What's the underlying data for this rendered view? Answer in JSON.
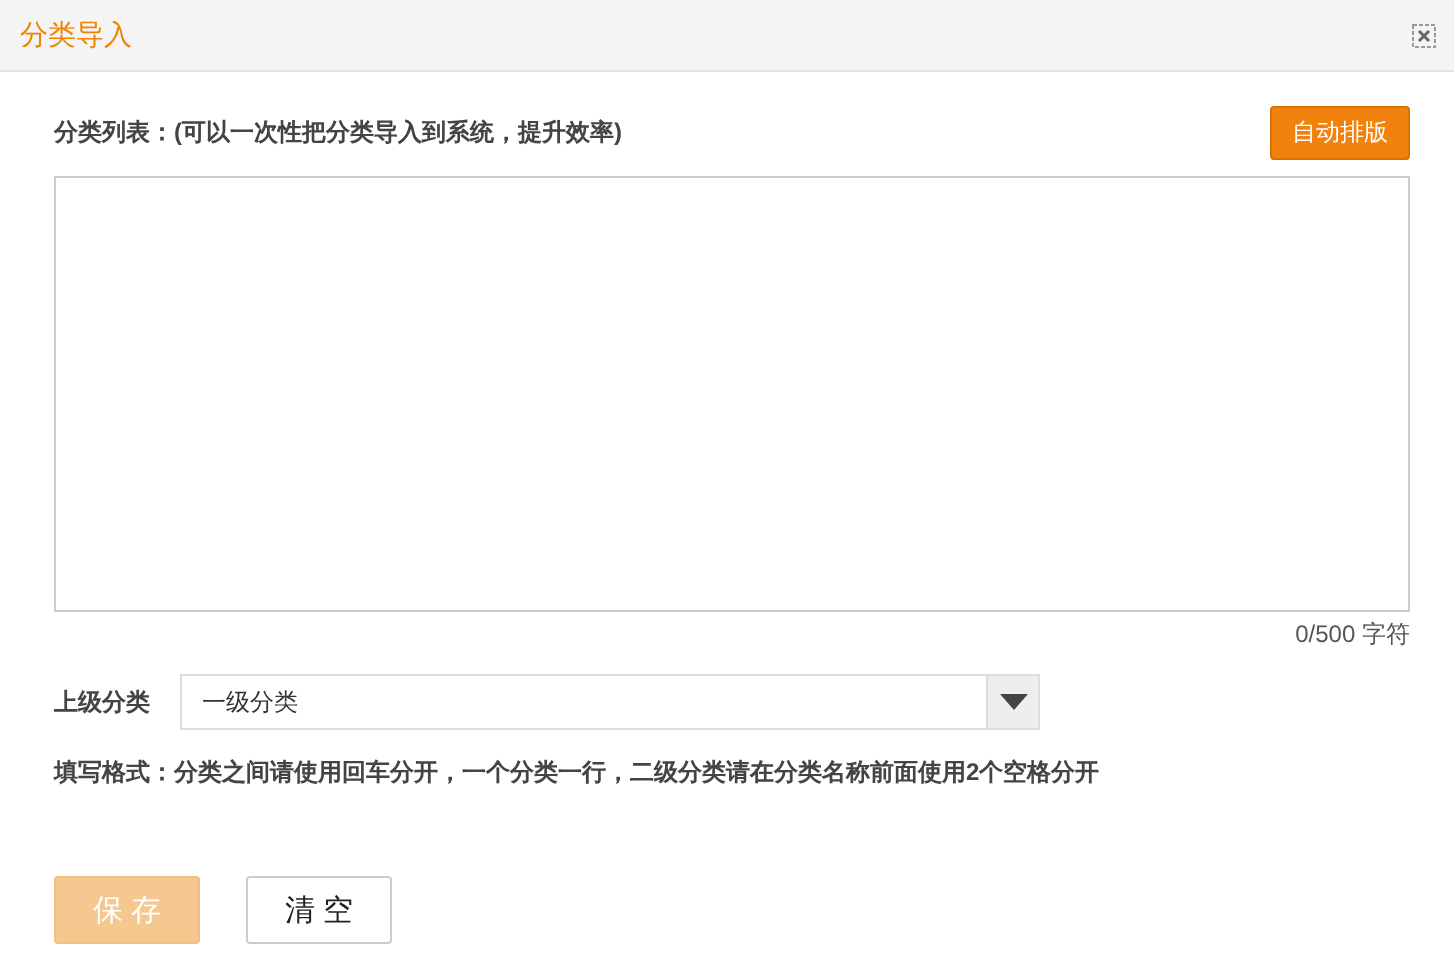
{
  "window": {
    "title": "分类导入"
  },
  "list_label": "分类列表：(可以一次性把分类导入到系统，提升效率)",
  "auto_format_button": "自动排版",
  "textarea": {
    "counter": "0/500 字符"
  },
  "parent": {
    "label": "上级分类",
    "value": "一级分类"
  },
  "hint": "填写格式：分类之间请使用回车分开，一个分类一行，二级分类请在分类名称前面使用2个空格分开",
  "buttons": [
    {
      "label": "保 存",
      "kind": "primary",
      "disabled": true
    },
    {
      "label": "清 空",
      "kind": "secondary",
      "disabled": false
    }
  ]
}
